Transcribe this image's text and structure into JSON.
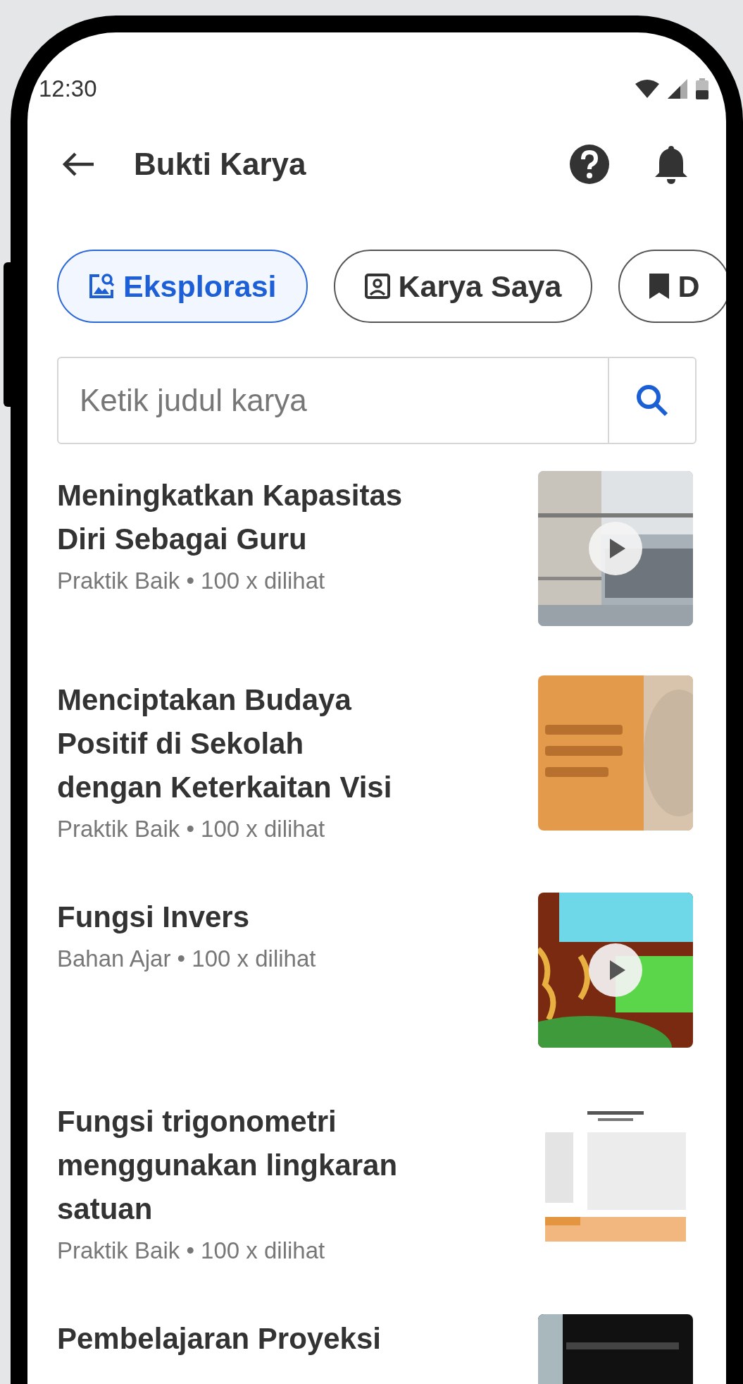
{
  "status_bar": {
    "time": "12:30"
  },
  "header": {
    "title": "Bukti Karya"
  },
  "tabs": [
    {
      "label": "Eksplorasi",
      "selected": true,
      "kind": "explore"
    },
    {
      "label": "Karya Saya",
      "selected": false,
      "kind": "portfolio"
    },
    {
      "label": "D",
      "selected": false,
      "kind": "saved"
    }
  ],
  "search": {
    "placeholder": "Ketik judul karya"
  },
  "items": [
    {
      "title": "Meningkatkan Kapasitas\nDiri Sebagai Guru",
      "meta": "Praktik Baik • 100 x dilihat",
      "video": true
    },
    {
      "title": "Menciptakan Budaya\nPositif di Sekolah\ndengan Keterkaitan Visi",
      "meta": "Praktik Baik • 100 x dilihat",
      "video": false
    },
    {
      "title": "Fungsi Invers",
      "meta": "Bahan Ajar • 100 x dilihat",
      "video": true
    },
    {
      "title": "Fungsi trigonometri\nmenggunakan lingkaran\nsatuan",
      "meta": "Praktik Baik • 100 x dilihat",
      "video": false
    },
    {
      "title": "Pembelajaran Proyeksi",
      "video": false
    }
  ]
}
